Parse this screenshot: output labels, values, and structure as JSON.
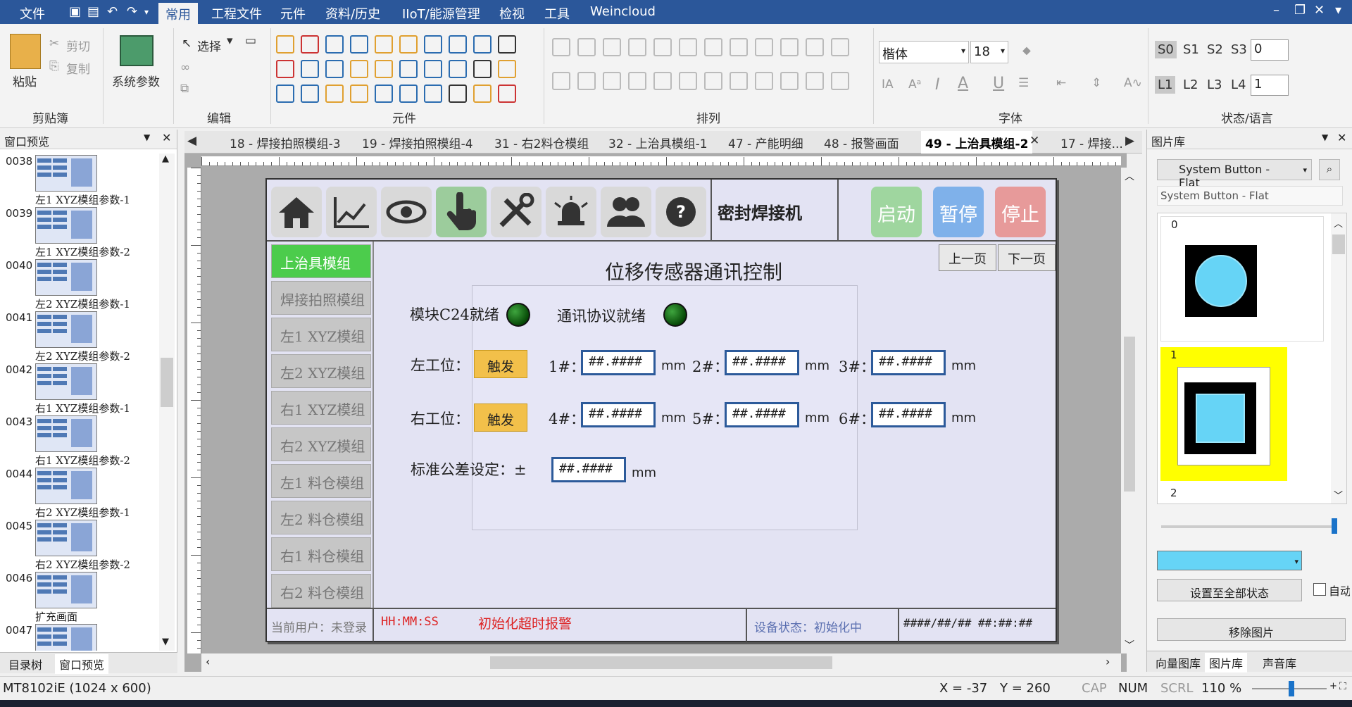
{
  "menu": {
    "file": "文件",
    "tabs": [
      "常用",
      "工程文件",
      "元件",
      "资料/历史",
      "IIoT/能源管理",
      "检视",
      "工具",
      "Weincloud"
    ],
    "active_tab": "常用"
  },
  "ribbon": {
    "paste": "粘贴",
    "cut": "剪切",
    "copy": "复制",
    "system_params": "系统参数",
    "select": "选择",
    "groups": {
      "clipboard": "剪贴簿",
      "edit": "编辑",
      "components": "元件",
      "arrange": "排列",
      "font": "字体",
      "state_lang": "状态/语言"
    },
    "font_name": "楷体",
    "font_size": "18",
    "states": [
      "S0",
      "S1",
      "S2",
      "S3"
    ],
    "state_value": "0",
    "langs": [
      "L1",
      "L2",
      "L3",
      "L4"
    ],
    "lang_value": "1"
  },
  "left_panel": {
    "title": "窗口预览",
    "items": [
      {
        "num": "0038",
        "caption": "左1 XYZ模组参数-1"
      },
      {
        "num": "0039",
        "caption": "左1 XYZ模组参数-2"
      },
      {
        "num": "0040",
        "caption": "左2 XYZ模组参数-1"
      },
      {
        "num": "0041",
        "caption": "左2 XYZ模组参数-2"
      },
      {
        "num": "0042",
        "caption": "右1 XYZ模组参数-1"
      },
      {
        "num": "0043",
        "caption": "右1 XYZ模组参数-2"
      },
      {
        "num": "0044",
        "caption": "右2 XYZ模组参数-1"
      },
      {
        "num": "0045",
        "caption": "右2 XYZ模组参数-2"
      },
      {
        "num": "0046",
        "caption": "扩充画面"
      },
      {
        "num": "0047",
        "caption": ""
      }
    ],
    "tabs": [
      "目录树",
      "窗口预览"
    ]
  },
  "doc_tabs": [
    {
      "label": "18 - 焊接拍照模组-3",
      "active": false
    },
    {
      "label": "19 - 焊接拍照模组-4",
      "active": false
    },
    {
      "label": "31 - 右2料仓模组",
      "active": false
    },
    {
      "label": "32 - 上治具模组-1",
      "active": false
    },
    {
      "label": "47 - 产能明细",
      "active": false
    },
    {
      "label": "48 - 报警画面",
      "active": false
    },
    {
      "label": "49 - 上治具模组-2",
      "active": true
    },
    {
      "label": "17 - 焊接...",
      "active": false
    }
  ],
  "hmi": {
    "machine_title": "密封焊接机",
    "start": "启动",
    "pause": "暂停",
    "stop": "停止",
    "side_menu": [
      "上治具模组",
      "焊接拍照模组",
      "左1 XYZ模组",
      "左2 XYZ模组",
      "右1 XYZ模组",
      "右2 XYZ模组",
      "左1 料仓模组",
      "左2 料仓模组",
      "右1 料仓模组",
      "右2 料仓模组"
    ],
    "prev_page": "上一页",
    "next_page": "下一页",
    "page_title": "位移传感器通讯控制",
    "module_ready": "模块C24就绪",
    "comm_ready": "通讯协议就绪",
    "left_station": "左工位：",
    "right_station": "右工位：",
    "trigger": "触发",
    "ch": [
      "1#：",
      "2#：",
      "3#：",
      "4#：",
      "5#：",
      "6#："
    ],
    "numfmt": "##.####",
    "unit": "mm",
    "tolerance": "标准公差设定：±",
    "status_user": "当前用户：未登录",
    "time": "HH:MM:SS",
    "alarm": "初始化超时报警",
    "device_status": "设备状态：初始化中",
    "datetime": "####/##/## ##:##:##"
  },
  "right_panel": {
    "title": "图片库",
    "dropdown": "System Button - Flat",
    "name_field": "System Button - Flat",
    "items": [
      "0",
      "1",
      "2"
    ],
    "set_all": "设置至全部状态",
    "auto": "自动",
    "remove": "移除图片",
    "tabs": [
      "向量图库",
      "图片库",
      "声音库"
    ]
  },
  "status": {
    "model": "MT8102iE (1024 x 600)",
    "x": "X = -37",
    "y": "Y = 260",
    "cap": "CAP",
    "num": "NUM",
    "scrl": "SCRL",
    "zoom": "110 %"
  },
  "colors": {
    "menubar": "#2b579a",
    "hmi_bg": "#e3e3f3",
    "selected_green": "#4ccc4c",
    "numbox_border": "#2c5a9a",
    "trigger": "#f2c04a"
  }
}
